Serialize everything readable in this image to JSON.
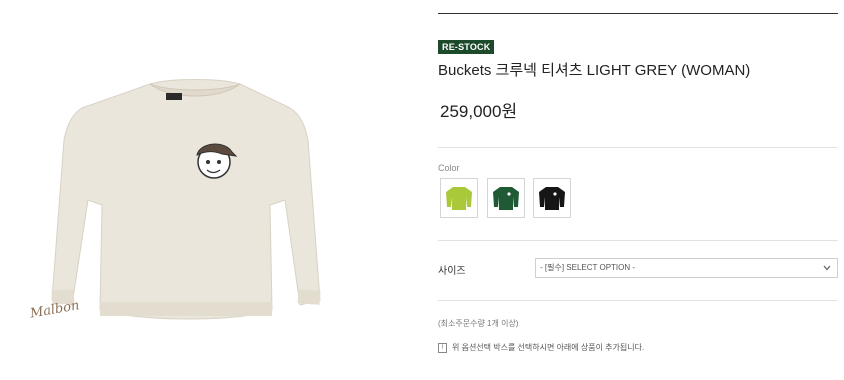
{
  "badge": "RE-STOCK",
  "product": {
    "title": "Buckets 크루넥 티셔츠 LIGHT GREY (WOMAN)",
    "price": "259,000원",
    "image_alt": "light grey crewneck sweatshirt",
    "logo_text": "Malbon"
  },
  "color": {
    "label": "Color",
    "options": [
      {
        "name": "lime",
        "hex": "#a9c83a"
      },
      {
        "name": "green",
        "hex": "#1f5a34"
      },
      {
        "name": "black",
        "hex": "#161616"
      }
    ]
  },
  "size": {
    "label": "사이즈",
    "select_value": "- [필수] SELECT OPTION -"
  },
  "min_qty": "(최소주문수량 1개 이상)",
  "notice": "위 옵션선택 박스를 선택하시면 아래에 상품이 추가됩니다.",
  "colors": {
    "badge": "#1e4a2c",
    "sweatshirt": "#ebe6dc"
  }
}
